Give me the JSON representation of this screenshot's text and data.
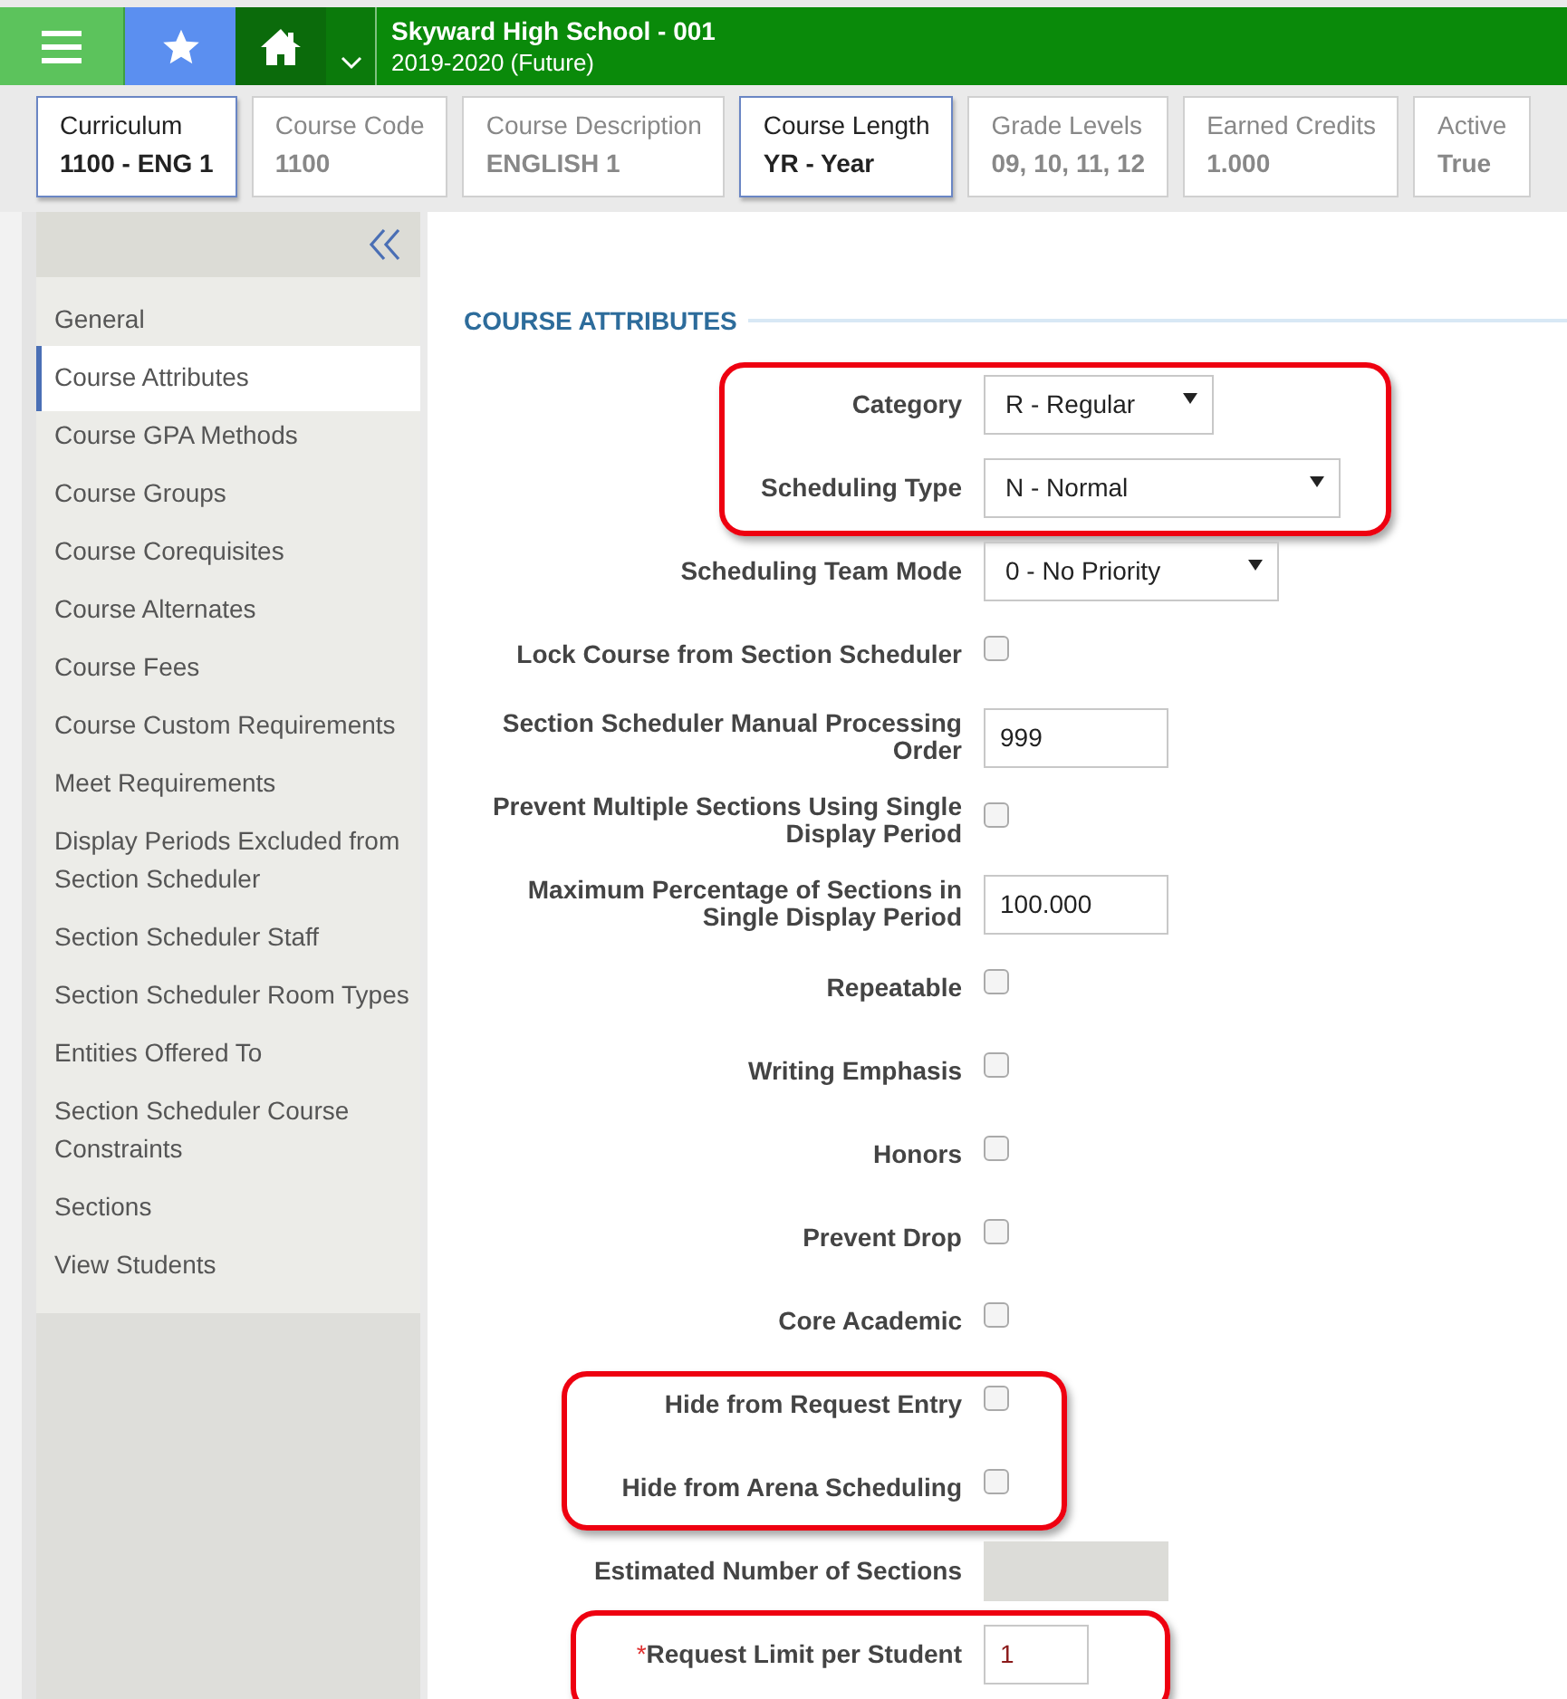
{
  "header": {
    "title": "Skyward High School - 001",
    "subtitle": "2019-2020 (Future)"
  },
  "info_cards": [
    {
      "label": "Curriculum",
      "value": "1100 - ENG 1",
      "active": true
    },
    {
      "label": "Course Code",
      "value": "1100",
      "active": false
    },
    {
      "label": "Course Description",
      "value": "ENGLISH 1",
      "active": false
    },
    {
      "label": "Course Length",
      "value": "YR - Year",
      "active": true
    },
    {
      "label": "Grade Levels",
      "value": "09, 10, 11, 12",
      "active": false
    },
    {
      "label": "Earned Credits",
      "value": "1.000",
      "active": false
    },
    {
      "label": "Active",
      "value": "True",
      "active": false
    }
  ],
  "sidebar": {
    "items": [
      {
        "label": "General",
        "selected": false
      },
      {
        "label": "Course Attributes",
        "selected": true
      },
      {
        "label": "Course GPA Methods",
        "selected": false
      },
      {
        "label": "Course Groups",
        "selected": false
      },
      {
        "label": "Course Corequisites",
        "selected": false
      },
      {
        "label": "Course Alternates",
        "selected": false
      },
      {
        "label": "Course Fees",
        "selected": false
      },
      {
        "label": "Course Custom Requirements",
        "selected": false
      },
      {
        "label": "Meet Requirements",
        "selected": false
      },
      {
        "label": "Display Periods Excluded from Section Scheduler",
        "selected": false
      },
      {
        "label": "Section Scheduler Staff",
        "selected": false
      },
      {
        "label": "Section Scheduler Room Types",
        "selected": false
      },
      {
        "label": "Entities Offered To",
        "selected": false
      },
      {
        "label": "Section Scheduler Course Constraints",
        "selected": false
      },
      {
        "label": "Sections",
        "selected": false
      },
      {
        "label": "View Students",
        "selected": false
      }
    ]
  },
  "section_title": "COURSE ATTRIBUTES",
  "field_groups": [
    {
      "highlighted": true,
      "fields": [
        {
          "kind": "select",
          "label": "Category",
          "value": "R - Regular"
        },
        {
          "kind": "select",
          "label": "Scheduling Type",
          "value": "N - Normal"
        }
      ]
    },
    {
      "highlighted": false,
      "fields": [
        {
          "kind": "select",
          "label": "Scheduling Team Mode",
          "value": "0 - No Priority"
        },
        {
          "kind": "checkbox",
          "label": "Lock Course from Section Scheduler",
          "checked": false
        },
        {
          "kind": "text",
          "label": "Section Scheduler Manual Processing Order",
          "value": "999"
        },
        {
          "kind": "checkbox",
          "label": "Prevent Multiple Sections Using Single Display Period",
          "checked": false
        },
        {
          "kind": "text",
          "label": "Maximum Percentage of Sections in Single Display Period",
          "value": "100.000"
        },
        {
          "kind": "checkbox",
          "label": "Repeatable",
          "checked": false
        },
        {
          "kind": "checkbox",
          "label": "Writing Emphasis",
          "checked": false
        },
        {
          "kind": "checkbox",
          "label": "Honors",
          "checked": false
        },
        {
          "kind": "checkbox",
          "label": "Prevent Drop",
          "checked": false
        },
        {
          "kind": "checkbox",
          "label": "Core Academic",
          "checked": false
        }
      ]
    },
    {
      "highlighted": true,
      "fields": [
        {
          "kind": "checkbox",
          "label": "Hide from Request Entry",
          "checked": false
        },
        {
          "kind": "checkbox",
          "label": "Hide from Arena Scheduling",
          "checked": false
        }
      ]
    },
    {
      "highlighted": false,
      "fields": [
        {
          "kind": "readonly",
          "label": "Estimated Number of Sections"
        }
      ]
    },
    {
      "highlighted": true,
      "fields": [
        {
          "kind": "text",
          "label": "Request Limit per Student",
          "required_mark": "*",
          "value": "1"
        }
      ]
    }
  ]
}
